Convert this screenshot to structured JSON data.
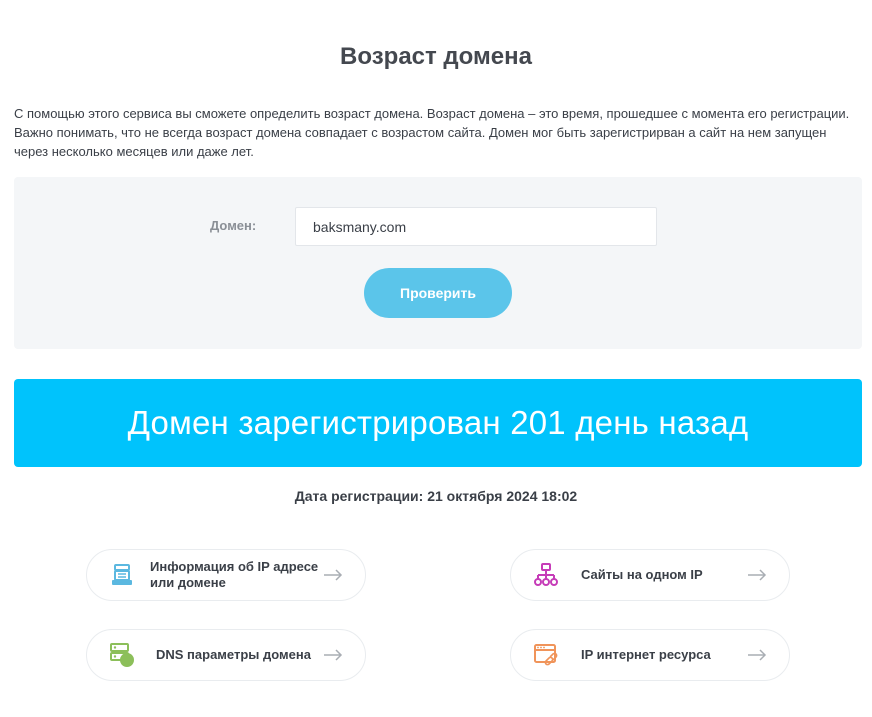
{
  "page": {
    "title": "Возраст домена",
    "intro": "С помощью этого сервиса вы сможете определить возраст домена. Возраст домена – это время, прошедшее с момента его регистрации. Важно понимать, что не всегда возраст домена совпадает с возрастом сайта. Домен мог быть зарегистрирван а сайт на нем запущен через несколько месяцев или даже лет."
  },
  "form": {
    "domain_label": "Домен:",
    "domain_value": "baksmany.com",
    "submit_label": "Проверить"
  },
  "result": {
    "banner_text": "Домен зарегистрирован 201 день назад",
    "registration_date": "Дата регистрации: 21 октября 2024 18:02"
  },
  "services": [
    {
      "label": "Информация об IP адресе или домене",
      "icon": "server-info-icon",
      "color": "#5bb8e0"
    },
    {
      "label": "Сайты на одном IP",
      "icon": "sitemap-icon",
      "color": "#c63cb8"
    },
    {
      "label": "DNS параметры домена",
      "icon": "dns-server-icon",
      "color": "#8cbf5a"
    },
    {
      "label": "IP интернет ресурса",
      "icon": "browser-link-icon",
      "color": "#f0945a"
    }
  ],
  "colors": {
    "accent": "#00c3fc",
    "button": "#5bc5ea",
    "panel": "#f4f6f8",
    "text": "#3a3f47"
  }
}
